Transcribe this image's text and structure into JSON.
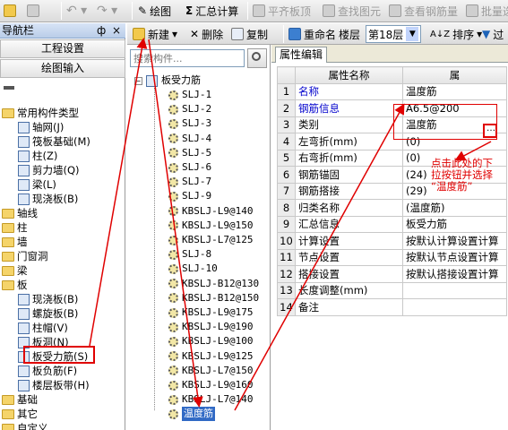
{
  "toolbar_top": {
    "draw": "绘图",
    "sum": "汇总计算",
    "flat_top": "平齐板顶",
    "find_elem": "查找图元",
    "view_rebar": "查看钢筋量",
    "batch": "批量选"
  },
  "toolbar_second": {
    "new": "新建",
    "delete": "删除",
    "copy": "复制",
    "rename": "重命名",
    "floor_label": "楼层",
    "floor_value": "第18层",
    "sort": "排序",
    "filter": "过"
  },
  "nav": {
    "title": "导航栏",
    "pin": "ф",
    "close": "×",
    "project_settings": "工程设置",
    "drawing_input": "绘图输入",
    "items": [
      {
        "label": "常用构件类型",
        "level": 0,
        "icon": "folder-icon"
      },
      {
        "label": "轴网(J)",
        "level": 1,
        "icon": "grid-icon"
      },
      {
        "label": "筏板基础(M)",
        "level": 1,
        "icon": "raft-foundation-icon"
      },
      {
        "label": "柱(Z)",
        "level": 1,
        "icon": "column-icon"
      },
      {
        "label": "剪力墙(Q)",
        "level": 1,
        "icon": "shear-wall-icon"
      },
      {
        "label": "梁(L)",
        "level": 1,
        "icon": "beam-icon"
      },
      {
        "label": "现浇板(B)",
        "level": 1,
        "icon": "slab-icon"
      },
      {
        "label": "轴线",
        "level": 0,
        "icon": "folder-icon"
      },
      {
        "label": "柱",
        "level": 0,
        "icon": "folder-icon"
      },
      {
        "label": "墙",
        "level": 0,
        "icon": "folder-icon"
      },
      {
        "label": "门窗洞",
        "level": 0,
        "icon": "folder-icon"
      },
      {
        "label": "梁",
        "level": 0,
        "icon": "folder-icon"
      },
      {
        "label": "板",
        "level": 0,
        "icon": "folder-icon"
      },
      {
        "label": "现浇板(B)",
        "level": 1,
        "icon": "slab-icon"
      },
      {
        "label": "螺旋板(B)",
        "level": 1,
        "icon": "spiral-slab-icon"
      },
      {
        "label": "柱帽(V)",
        "level": 1,
        "icon": "column-cap-icon"
      },
      {
        "label": "板洞(N)",
        "level": 1,
        "icon": "slab-hole-icon"
      },
      {
        "label": "板受力筋(S)",
        "level": 1,
        "icon": "slab-rebar-icon"
      },
      {
        "label": "板负筋(F)",
        "level": 1,
        "icon": "negative-rebar-icon"
      },
      {
        "label": "楼层板带(H)",
        "level": 1,
        "icon": "floor-strip-icon"
      },
      {
        "label": "基础",
        "level": 0,
        "icon": "folder-icon"
      },
      {
        "label": "其它",
        "level": 0,
        "icon": "folder-icon"
      },
      {
        "label": "自定义",
        "level": 0,
        "icon": "folder-icon"
      }
    ]
  },
  "component_list": {
    "search_placeholder": "搜索构件...",
    "root": "板受力筋",
    "items": [
      "SLJ-1",
      "SLJ-2",
      "SLJ-3",
      "SLJ-4",
      "SLJ-5",
      "SLJ-6",
      "SLJ-7",
      "SLJ-9",
      "KBSLJ-L9@140",
      "KBSLJ-L9@150",
      "KBSLJ-L7@125",
      "SLJ-8",
      "SLJ-10",
      "KBSLJ-B12@130",
      "KBSLJ-B12@150",
      "KBSLJ-L9@175",
      "KBSLJ-L9@190",
      "KBSLJ-L9@100",
      "KBSLJ-L9@125",
      "KBSLJ-L7@150",
      "KBSLJ-L9@160",
      "KBSLJ-L7@140",
      "温度筋"
    ],
    "selected": "温度筋"
  },
  "properties": {
    "tab": "属性编辑",
    "col_name": "属性名称",
    "col_value": "属",
    "rows": [
      {
        "no": "1",
        "name": "名称",
        "value": "温度筋",
        "highlight": true
      },
      {
        "no": "2",
        "name": "钢筋信息",
        "value": "A6.5@200",
        "highlight": true
      },
      {
        "no": "3",
        "name": "类别",
        "value": "温度筋",
        "highlight": false
      },
      {
        "no": "4",
        "name": "左弯折(mm)",
        "value": "(0)",
        "highlight": false
      },
      {
        "no": "5",
        "name": "右弯折(mm)",
        "value": "(0)",
        "highlight": false
      },
      {
        "no": "6",
        "name": "钢筋锚固",
        "value": "(24)",
        "highlight": false
      },
      {
        "no": "7",
        "name": "钢筋搭接",
        "value": "(29)",
        "highlight": false
      },
      {
        "no": "8",
        "name": "归类名称",
        "value": "(温度筋)",
        "highlight": false
      },
      {
        "no": "9",
        "name": "汇总信息",
        "value": "板受力筋",
        "highlight": false
      },
      {
        "no": "10",
        "name": "计算设置",
        "value": "按默认计算设置计算",
        "highlight": false
      },
      {
        "no": "11",
        "name": "节点设置",
        "value": "按默认节点设置计算",
        "highlight": false
      },
      {
        "no": "12",
        "name": "搭接设置",
        "value": "按默认搭接设置计算",
        "highlight": false
      },
      {
        "no": "13",
        "name": "长度调整(mm)",
        "value": "",
        "highlight": false
      },
      {
        "no": "14",
        "name": "备注",
        "value": "",
        "highlight": false
      }
    ]
  },
  "annotation": {
    "line1": "点击此处的下",
    "line2": "拉按钮并选择",
    "line3": "“温度筋”"
  },
  "colors": {
    "annotation_red": "#e00000",
    "selection_blue": "#316ac5",
    "highlight_label": "#0000cc"
  }
}
